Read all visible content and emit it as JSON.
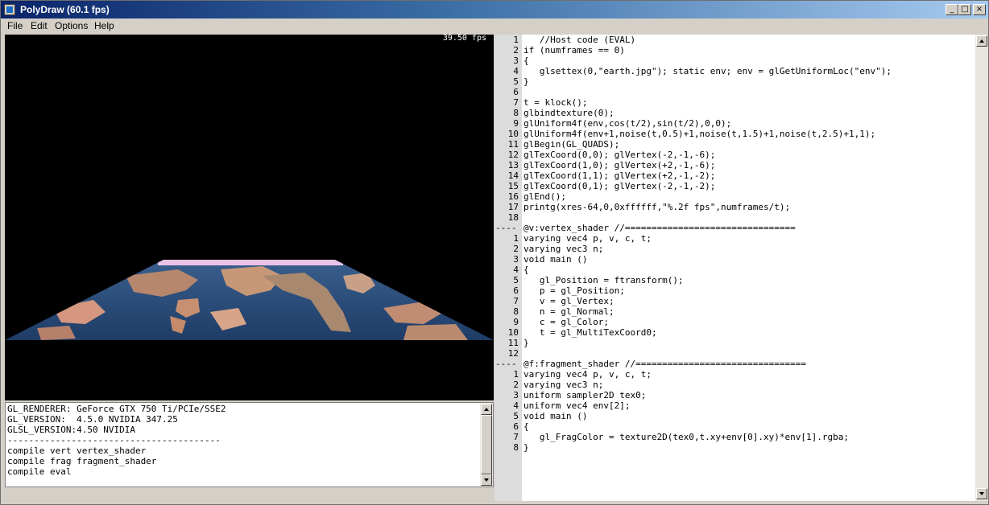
{
  "window": {
    "title": "PolyDraw (60.1 fps)",
    "controls": {
      "minimize": "_",
      "maximize": "□",
      "close": "×"
    }
  },
  "menu": [
    "File",
    "Edit",
    "Options",
    "Help"
  ],
  "viewport": {
    "fps_label": "39.50 fps",
    "background": "#000000",
    "textured_quad": {
      "texture": "earth.jpg"
    }
  },
  "console": {
    "lines": [
      "GL_RENDERER: GeForce GTX 750 Ti/PCIe/SSE2",
      "GL_VERSION:  4.5.0 NVIDIA 347.25",
      "GLSL_VERSION:4.50 NVIDIA",
      "----------------------------------------",
      "compile vert vertex_shader",
      "compile frag fragment_shader",
      "compile eval"
    ]
  },
  "editor": {
    "lines": [
      {
        "n": "1",
        "t": "   //Host code (EVAL)"
      },
      {
        "n": "2",
        "t": "if (numframes == 0)"
      },
      {
        "n": "3",
        "t": "{"
      },
      {
        "n": "4",
        "t": "   glsettex(0,\"earth.jpg\"); static env; env = glGetUniformLoc(\"env\");"
      },
      {
        "n": "5",
        "t": "}"
      },
      {
        "n": "6",
        "t": ""
      },
      {
        "n": "7",
        "t": "t = klock();"
      },
      {
        "n": "8",
        "t": "glbindtexture(0);"
      },
      {
        "n": "9",
        "t": "glUniform4f(env,cos(t/2),sin(t/2),0,0);"
      },
      {
        "n": "10",
        "t": "glUniform4f(env+1,noise(t,0.5)+1,noise(t,1.5)+1,noise(t,2.5)+1,1);"
      },
      {
        "n": "11",
        "t": "glBegin(GL_QUADS);"
      },
      {
        "n": "12",
        "t": "glTexCoord(0,0); glVertex(-2,-1,-6);"
      },
      {
        "n": "13",
        "t": "glTexCoord(1,0); glVertex(+2,-1,-6);"
      },
      {
        "n": "14",
        "t": "glTexCoord(1,1); glVertex(+2,-1,-2);"
      },
      {
        "n": "15",
        "t": "glTexCoord(0,1); glVertex(-2,-1,-2);"
      },
      {
        "n": "16",
        "t": "glEnd();"
      },
      {
        "n": "17",
        "t": "printg(xres-64,0,0xffffff,\"%.2f fps\",numframes/t);"
      },
      {
        "n": "18",
        "t": ""
      },
      {
        "n": "----",
        "t": "@v:vertex_shader //================================",
        "sep": true
      },
      {
        "n": "1",
        "t": "varying vec4 p, v, c, t;"
      },
      {
        "n": "2",
        "t": "varying vec3 n;"
      },
      {
        "n": "3",
        "t": "void main ()"
      },
      {
        "n": "4",
        "t": "{"
      },
      {
        "n": "5",
        "t": "   gl_Position = ftransform();"
      },
      {
        "n": "6",
        "t": "   p = gl_Position;"
      },
      {
        "n": "7",
        "t": "   v = gl_Vertex;"
      },
      {
        "n": "8",
        "t": "   n = gl_Normal;"
      },
      {
        "n": "9",
        "t": "   c = gl_Color;"
      },
      {
        "n": "10",
        "t": "   t = gl_MultiTexCoord0;"
      },
      {
        "n": "11",
        "t": "}"
      },
      {
        "n": "12",
        "t": ""
      },
      {
        "n": "----",
        "t": "@f:fragment_shader //================================",
        "sep": true
      },
      {
        "n": "1",
        "t": "varying vec4 p, v, c, t;"
      },
      {
        "n": "2",
        "t": "varying vec3 n;"
      },
      {
        "n": "3",
        "t": "uniform sampler2D tex0;"
      },
      {
        "n": "4",
        "t": "uniform vec4 env[2];"
      },
      {
        "n": "5",
        "t": "void main ()"
      },
      {
        "n": "6",
        "t": "{"
      },
      {
        "n": "7",
        "t": "   gl_FragColor = texture2D(tex0,t.xy+env[0].xy)*env[1].rgba;"
      },
      {
        "n": "8",
        "t": "}"
      }
    ]
  }
}
